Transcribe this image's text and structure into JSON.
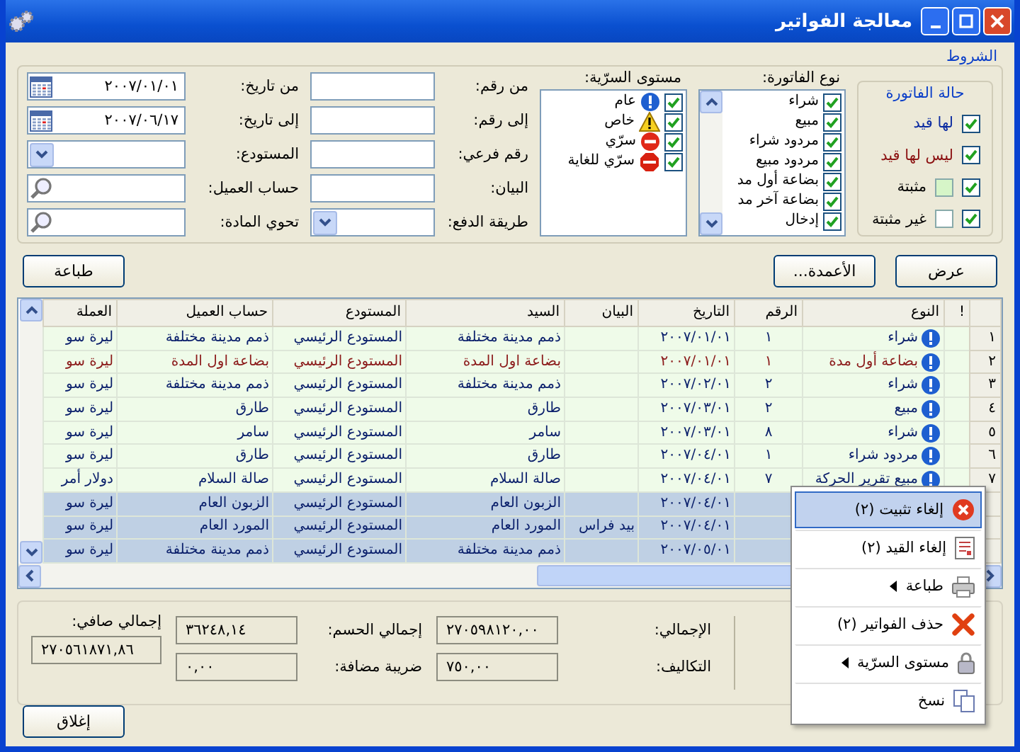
{
  "window": {
    "title": "معالجة الفواتير"
  },
  "conditions": {
    "title": "الشروط",
    "status": {
      "title": "حالة الفاتورة",
      "items": [
        {
          "label": "لها قيد",
          "checked": true,
          "kind": "text",
          "color": "#0a2aa0"
        },
        {
          "label": "ليس لها قيد",
          "checked": true,
          "kind": "text",
          "color": "#8b1010"
        },
        {
          "label": "مثبتة",
          "checked": true,
          "kind": "swatch",
          "color": "#d6f5c8"
        },
        {
          "label": "غير مثبتة",
          "checked": true,
          "kind": "swatch",
          "color": "#ffffff"
        }
      ]
    },
    "invoice_types": {
      "label": "نوع الفاتورة:",
      "items": [
        {
          "label": "شراء",
          "checked": true
        },
        {
          "label": "مبيع",
          "checked": true
        },
        {
          "label": "مردود شراء",
          "checked": true
        },
        {
          "label": "مردود مبيع",
          "checked": true
        },
        {
          "label": "بضاعة أول مد",
          "checked": true
        },
        {
          "label": "بضاعة آخر مد",
          "checked": true
        },
        {
          "label": "إدخال",
          "checked": true
        }
      ]
    },
    "security": {
      "label": "مستوى السرّية:",
      "items": [
        {
          "label": "عام",
          "checked": true,
          "kind": "info"
        },
        {
          "label": "خاص",
          "checked": true,
          "kind": "warning"
        },
        {
          "label": "سرّي",
          "checked": true,
          "kind": "no-entry"
        },
        {
          "label": "سرّي للغاية",
          "checked": true,
          "kind": "stop"
        }
      ]
    },
    "fields": [
      {
        "label": "من رقم:",
        "kind": "text"
      },
      {
        "label": "إلى رقم:",
        "kind": "text"
      },
      {
        "label": "رقم فرعي:",
        "kind": "text"
      },
      {
        "label": "البيان:",
        "kind": "text"
      },
      {
        "label": "طريقة الدفع:",
        "kind": "dropdown"
      }
    ],
    "dates": [
      {
        "label": "من تاريخ:",
        "kind": "date",
        "value": "٢٠٠٧/٠١/٠١"
      },
      {
        "label": "إلى تاريخ:",
        "kind": "date",
        "value": "٢٠٠٧/٠٦/١٧"
      },
      {
        "label": "المستودع:",
        "kind": "dropdown"
      },
      {
        "label": "حساب العميل:",
        "kind": "search"
      },
      {
        "label": "تحوي المادة:",
        "kind": "search"
      }
    ]
  },
  "actions": {
    "show": "عرض",
    "columns": "الأعمدة...",
    "print": "طباعة"
  },
  "table": {
    "columns": [
      "!",
      "النوع",
      "الرقم",
      "التاريخ",
      "البيان",
      "السيد",
      "المستودع",
      "حساب العميل",
      "العملة"
    ],
    "rows": [
      {
        "index": "١",
        "type": "شراء",
        "number": "١",
        "date": "٢٠٠٧/٠١/٠١",
        "party": "ذمم مدينة مختلفة",
        "store": "المستودع الرئيسي",
        "account": "ذمم مدينة مختلفة",
        "currency": "ليرة سو",
        "color": "#0a1f6b",
        "selected": false
      },
      {
        "index": "٢",
        "type": "بضاعة أول مدة",
        "number": "١",
        "date": "٢٠٠٧/٠١/٠١",
        "party": "بضاعة اول المدة",
        "store": "المستودع الرئيسي",
        "account": "بضاعة اول المدة",
        "currency": "ليرة سو",
        "color": "#8b1a1a",
        "selected": false
      },
      {
        "index": "٣",
        "type": "شراء",
        "number": "٢",
        "date": "٢٠٠٧/٠٢/٠١",
        "party": "ذمم مدينة مختلفة",
        "store": "المستودع الرئيسي",
        "account": "ذمم مدينة مختلفة",
        "currency": "ليرة سو",
        "color": "#0a1f6b",
        "selected": false
      },
      {
        "index": "٤",
        "type": "مبيع",
        "number": "٢",
        "date": "٢٠٠٧/٠٣/٠١",
        "party": "طارق",
        "store": "المستودع الرئيسي",
        "account": "طارق",
        "currency": "ليرة سو",
        "color": "#0a1f6b",
        "selected": false
      },
      {
        "index": "٥",
        "type": "شراء",
        "number": "٨",
        "date": "٢٠٠٧/٠٣/٠١",
        "party": "سامر",
        "store": "المستودع الرئيسي",
        "account": "سامر",
        "currency": "ليرة سو",
        "color": "#0a1f6b",
        "selected": false
      },
      {
        "index": "٦",
        "type": "مردود شراء",
        "number": "١",
        "date": "٢٠٠٧/٠٤/٠١",
        "party": "طارق",
        "store": "المستودع الرئيسي",
        "account": "طارق",
        "currency": "ليرة سو",
        "color": "#0a1f6b",
        "selected": false
      },
      {
        "index": "٧",
        "type": "مبيع تقرير الحركة",
        "number": "٧",
        "date": "٢٠٠٧/٠٤/٠١",
        "party": "صالة السلام",
        "store": "المستودع الرئيسي",
        "account": "صالة السلام",
        "currency": "دولار أمر",
        "color": "#0a1f6b",
        "selected": false
      },
      {
        "date": "٢٠٠٧/٠٤/٠١",
        "party": "الزبون العام",
        "store": "المستودع الرئيسي",
        "account": "الزبون العام",
        "currency": "ليرة سو",
        "color": "#0a1f6b",
        "selected": true
      },
      {
        "date": "٢٠٠٧/٠٤/٠١",
        "note": "بيد فراس",
        "party": "المورد العام",
        "store": "المستودع الرئيسي",
        "account": "المورد العام",
        "currency": "ليرة سو",
        "color": "#0a1f6b",
        "selected": true
      },
      {
        "date": "٢٠٠٧/٠٥/٠١",
        "party": "ذمم مدينة مختلفة",
        "store": "المستودع الرئيسي",
        "account": "ذمم مدينة مختلفة",
        "currency": "ليرة سو",
        "color": "#0a1f6b",
        "selected": true
      }
    ]
  },
  "totals": [
    {
      "label": "الإجمالي:",
      "value": "٢٧٠٥٩٨١٢٠,٠٠"
    },
    {
      "label": "التكاليف:",
      "value": "٧٥٠,٠٠"
    },
    {
      "label": "إجمالي الحسم:",
      "value": "٣٦٢٤٨,١٤"
    },
    {
      "label": "ضريبة مضافة:",
      "value": "٠,٠٠"
    },
    {
      "label": "إجمالي صافي:",
      "value": "٢٧٠٥٦١٨٧١,٨٦"
    }
  ],
  "close_button": "إغلاق",
  "context_menu": {
    "items": [
      {
        "label": "إلغاء تثبيت (٢)",
        "kind": "unpin",
        "submenu": false,
        "selected": true
      },
      {
        "label": "إلغاء القيد (٢)",
        "kind": "ledger",
        "submenu": false,
        "selected": false
      },
      {
        "label": "طباعة",
        "kind": "printer",
        "submenu": true,
        "selected": false
      },
      {
        "label": "حذف الفواتير (٢)",
        "kind": "delete",
        "submenu": false,
        "selected": false
      },
      {
        "label": "مستوى السرّية",
        "kind": "lock",
        "submenu": true,
        "selected": false
      },
      {
        "label": "نسخ",
        "kind": "copy",
        "submenu": false,
        "selected": false
      }
    ]
  }
}
